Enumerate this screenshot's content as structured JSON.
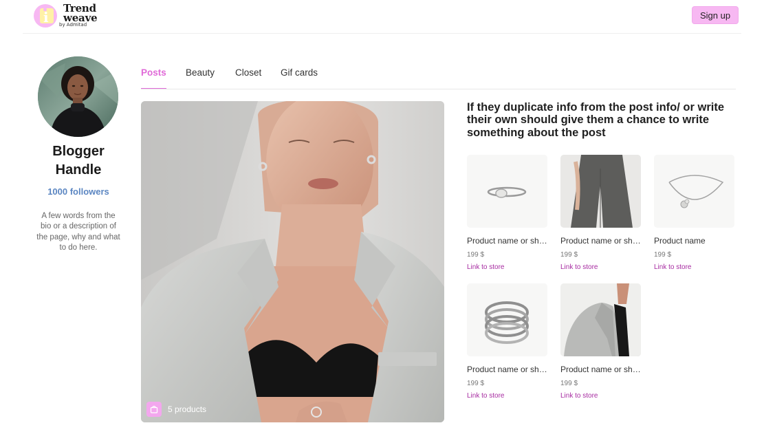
{
  "brand": {
    "name_line1": "Trend",
    "name_line2": "weave",
    "by": "by Admitad",
    "accent_color": "#f3a7ee"
  },
  "header": {
    "signup_label": "Sign up"
  },
  "profile": {
    "name": "Blogger Handle",
    "followers": "1000 followers",
    "bio": "A few words from the bio or a description of the page, why and what to do here."
  },
  "tabs": [
    {
      "label": "Posts",
      "active": true
    },
    {
      "label": "Beauty",
      "active": false
    },
    {
      "label": "Closet",
      "active": false
    },
    {
      "label": "Gif cards",
      "active": false
    }
  ],
  "post": {
    "products_count": "5 products",
    "description": "If they duplicate info from the post info/ or write their own should give them a chance to write something about the post",
    "bag_icon": "shopping-bag-icon"
  },
  "products": [
    {
      "name": "Product name or short description",
      "price": "199 $",
      "link": "Link to store",
      "image": "ring-icon"
    },
    {
      "name": "Product name or short description",
      "price": "199 $",
      "link": "Link to store",
      "image": "trousers-image"
    },
    {
      "name": "Product name",
      "price": "199 $",
      "link": "Link to store",
      "image": "necklace-icon"
    },
    {
      "name": "Product name or short description",
      "price": "199 $",
      "link": "Link to store",
      "image": "stacked-rings-icon"
    },
    {
      "name": "Product name or short description",
      "price": "199 $",
      "link": "Link to store",
      "image": "blazer-image"
    }
  ]
}
